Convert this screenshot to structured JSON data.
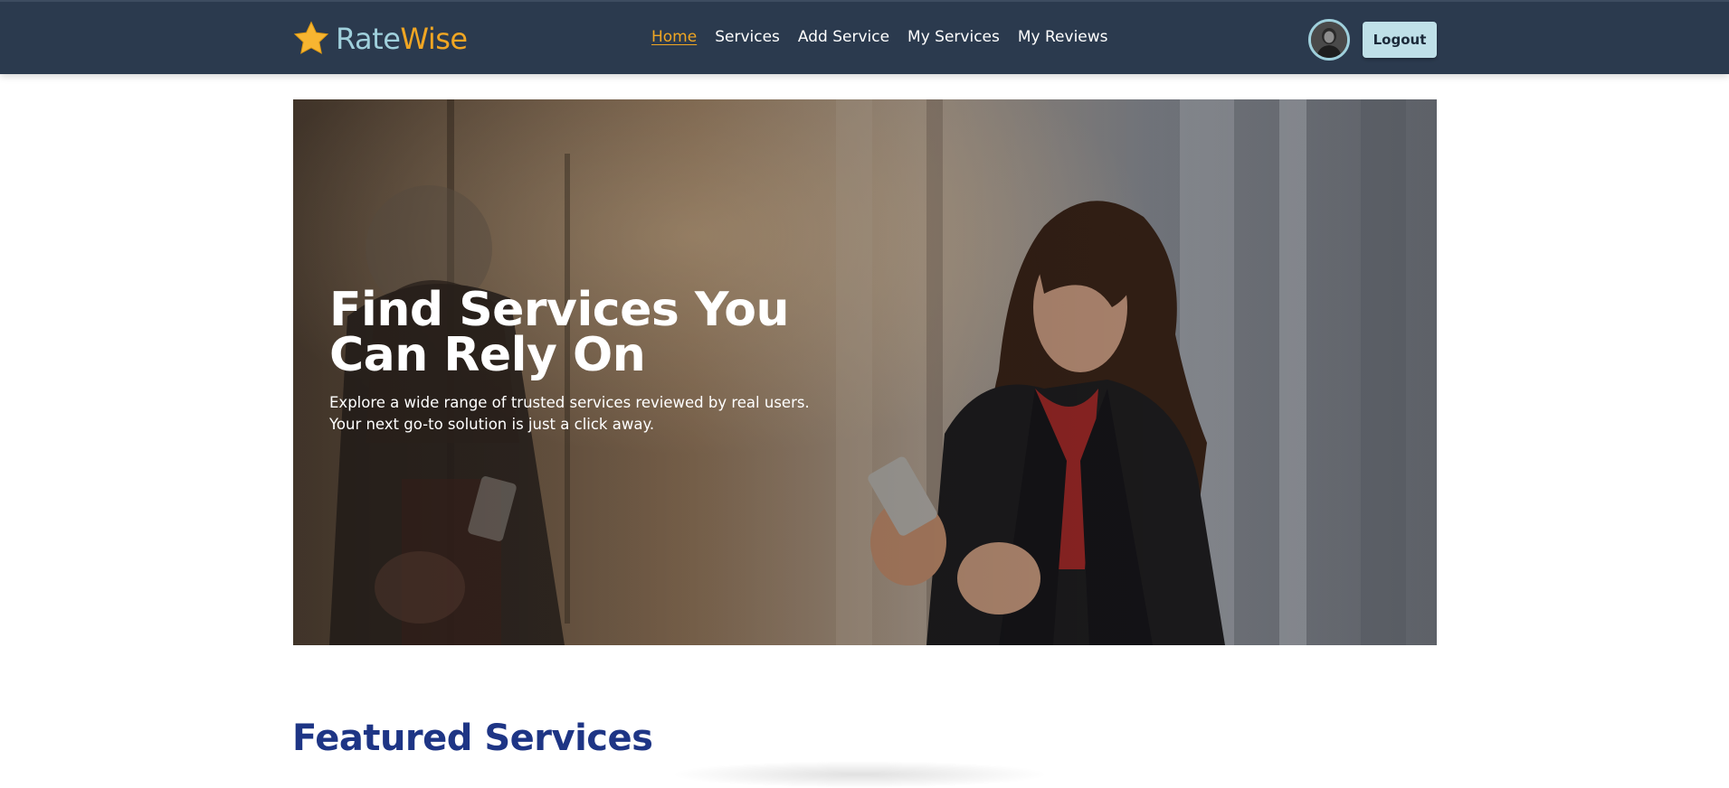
{
  "brand": {
    "part1": "Rate",
    "part2": "Wise",
    "icon": "star-icon",
    "colors": {
      "rate": "#9fd0dc",
      "wise": "#f0a623",
      "star": "#f7b531"
    }
  },
  "nav": {
    "items": [
      {
        "label": "Home",
        "active": true
      },
      {
        "label": "Services",
        "active": false
      },
      {
        "label": "Add Service",
        "active": false
      },
      {
        "label": "My Services",
        "active": false
      },
      {
        "label": "My Reviews",
        "active": false
      }
    ]
  },
  "user": {
    "avatar_icon": "user-avatar",
    "logout_label": "Logout"
  },
  "hero": {
    "title": "Find Services You Can Rely On",
    "subtitle": "Explore a wide range of trusted services reviewed by real users. Your next go-to solution is just a click away."
  },
  "featured": {
    "title": "Featured Services",
    "subtitle": ""
  },
  "colors": {
    "navbar": "#2b3a4e",
    "accent": "#f0a623",
    "heading": "#1e3585",
    "button": "#bfe0e8"
  }
}
